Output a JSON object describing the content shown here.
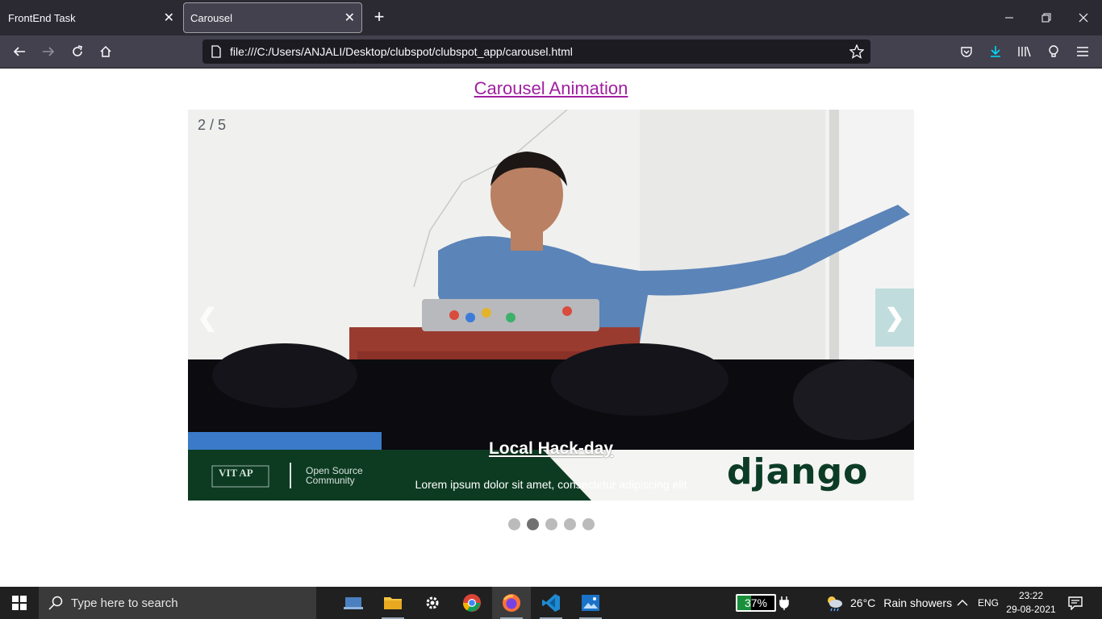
{
  "browser": {
    "tabs": [
      {
        "label": "FrontEnd Task",
        "active": false
      },
      {
        "label": "Carousel",
        "active": true
      }
    ],
    "url": "file:///C:/Users/ANJALI/Desktop/clubspot/clubspot_app/carousel.html"
  },
  "page": {
    "title": "Carousel Animation",
    "carousel": {
      "counter": "2 / 5",
      "prev_label": "❮",
      "next_label": "❯",
      "caption_title": "Local Hack-day",
      "caption_text": "Lorem ipsum dolor sit amet, consectetur adipiscing elit",
      "slide_overlay": {
        "logo_text_1": "VIT AP",
        "logo_text_2": "Open Source Community",
        "brand": "django"
      },
      "total_slides": 5,
      "active_index": 1
    }
  },
  "taskbar": {
    "search_placeholder": "Type here to search",
    "apps": [
      "task-view",
      "file-explorer",
      "settings",
      "chrome",
      "firefox",
      "vscode",
      "photos"
    ],
    "active_app": "firefox",
    "battery": "37%",
    "battery_level": 0.37,
    "weather_temp": "26°C",
    "weather_desc": "Rain showers",
    "language": "ENG",
    "time": "23:22",
    "date": "29-08-2021"
  },
  "colors": {
    "title_link": "#a020a0",
    "chrome_dark": "#2b2a33",
    "taskbar": "#202020",
    "dot_active": "#717171",
    "dot": "#bbbbbb"
  }
}
